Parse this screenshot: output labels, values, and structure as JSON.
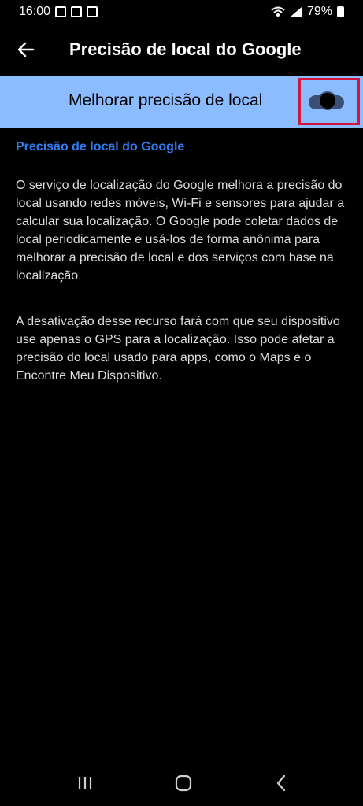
{
  "status_bar": {
    "time": "16:00",
    "battery": "79%",
    "icons": [
      "photo-icon",
      "message-icon",
      "square-icon",
      "wifi-icon",
      "signal-icon",
      "battery-icon"
    ]
  },
  "header": {
    "title": "Precisão de local do Google",
    "back_icon": "arrow-left-icon"
  },
  "setting": {
    "label": "Melhorar precisão de local",
    "enabled": true,
    "accent_color": "#8bbcff"
  },
  "content": {
    "section_title": "Precisão de local do Google",
    "paragraph_1": "O serviço de localização do Google melhora a precisão do local usando redes móveis, Wi-Fi e sensores para ajudar a calcular sua localização. O Google pode coletar dados de local periodicamente e usá-los de forma anônima para melhorar a precisão de local e dos serviços com base na localização.",
    "paragraph_2": "A desativação desse recurso fará com que seu dispositivo use apenas o GPS para a localização. Isso pode afetar a precisão do local usado para apps, como o Maps e o Encontre Meu Dispositivo."
  },
  "navigation": {
    "items": [
      "recent-apps-icon",
      "home-icon",
      "back-icon"
    ]
  }
}
